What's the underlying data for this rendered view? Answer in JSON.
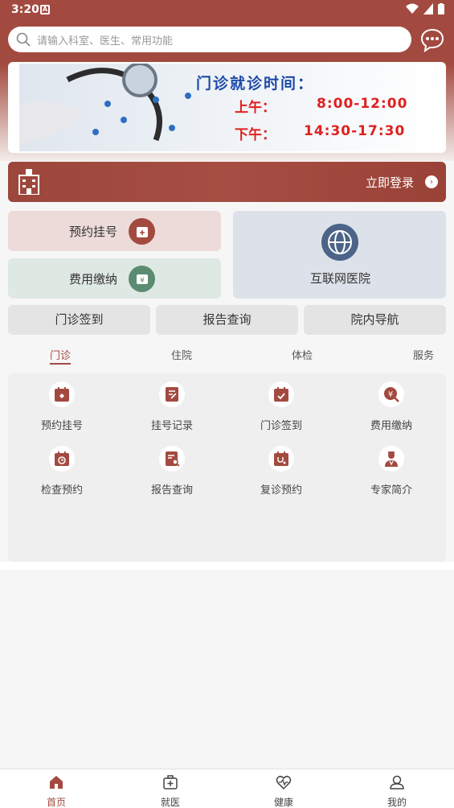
{
  "status_bar": {
    "time": "3:20"
  },
  "search": {
    "placeholder": "请输入科室、医生、常用功能"
  },
  "banner": {
    "title": "门诊就诊时间：",
    "morning_label": "上午：",
    "morning_time": "8:00-12:00",
    "afternoon_label": "下午：",
    "afternoon_time": "14:30-17:30"
  },
  "login": {
    "label": "立即登录"
  },
  "quick_cards": {
    "booking": "预约挂号",
    "payment": "费用缴纳",
    "internet_hospital": "互联网医院"
  },
  "gray_buttons": [
    "门诊签到",
    "报告查询",
    "院内导航"
  ],
  "tabs": [
    "门诊",
    "住院",
    "体检",
    "服务"
  ],
  "active_tab": "门诊",
  "grid_items": [
    "预约挂号",
    "挂号记录",
    "门诊签到",
    "费用缴纳",
    "检查预约",
    "报告查询",
    "复诊预约",
    "专家简介"
  ],
  "bottom_nav": [
    "首页",
    "就医",
    "健康",
    "我的"
  ],
  "colors": {
    "accent": "#a34a40",
    "banner_title": "#1e4aa8",
    "banner_time": "#e02020"
  }
}
